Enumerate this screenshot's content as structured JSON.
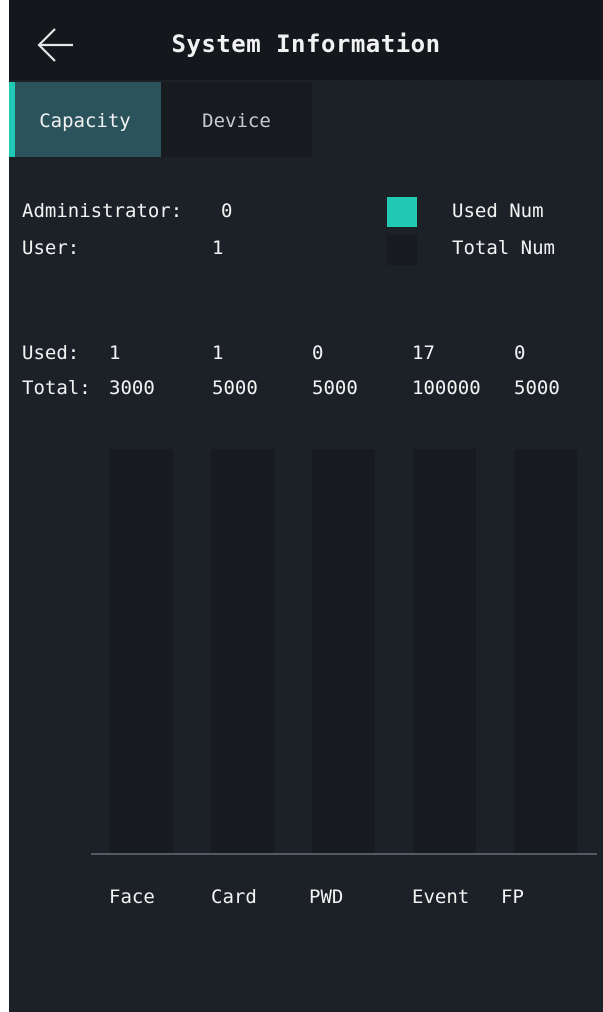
{
  "header": {
    "title": "System Information",
    "back_icon": "arrow-left-icon"
  },
  "tabs": [
    {
      "label": "Capacity",
      "active": true
    },
    {
      "label": "Device",
      "active": false
    }
  ],
  "summary": {
    "administrator_label": "Administrator:",
    "administrator_value": "0",
    "user_label": "User:",
    "user_value": "1"
  },
  "legend": [
    {
      "label": "Used Num",
      "color": "#1fc9b4"
    },
    {
      "label": "Total Num",
      "color": "#171a1f"
    }
  ],
  "table": {
    "used_label": "Used:",
    "total_label": "Total:"
  },
  "colors": {
    "accent": "#1fc9b4",
    "background": "#1c2127",
    "header": "#14181c"
  },
  "chart_data": {
    "type": "bar",
    "categories": [
      "Face",
      "Card",
      "PWD",
      "Event",
      "FP"
    ],
    "series": [
      {
        "name": "Used Num",
        "values": [
          1,
          1,
          0,
          17,
          0
        ]
      },
      {
        "name": "Total Num",
        "values": [
          3000,
          5000,
          5000,
          100000,
          5000
        ]
      }
    ],
    "used_text": [
      "1",
      "1",
      "0",
      "17",
      "0"
    ],
    "total_text": [
      "3000",
      "5000",
      "5000",
      "100000",
      "5000"
    ],
    "legend_position": "top-right"
  }
}
